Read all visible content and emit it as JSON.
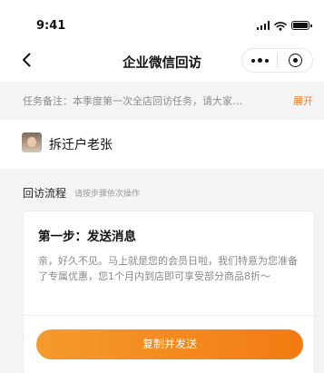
{
  "status_bar": {
    "time": "9:41",
    "icons": [
      "cellular-signal-icon",
      "wifi-icon",
      "battery-icon"
    ]
  },
  "nav": {
    "title": "企业微信回访",
    "back_icon": "chevron-left-icon",
    "more_icon": "more-dots-icon",
    "close_icon": "target-circle-icon"
  },
  "task_note": {
    "text": "任务备注：本季度第一次全店回访任务，请大家…",
    "expand_label": "展开",
    "expand_color": "#f5781f"
  },
  "customer": {
    "name": "拆迁户老张",
    "avatar_icon": "avatar"
  },
  "flow": {
    "title": "回访流程",
    "hint": "请按步骤依次操作"
  },
  "step": {
    "title": "第一步：发送消息",
    "message": "亲，好久不见。马上就是您的会员日啦，我们特意为您准备了专属优惠，您1个月内到店即可享受部分商品8折～",
    "button_label": "复制并发送",
    "button_color": "#f27b12"
  }
}
